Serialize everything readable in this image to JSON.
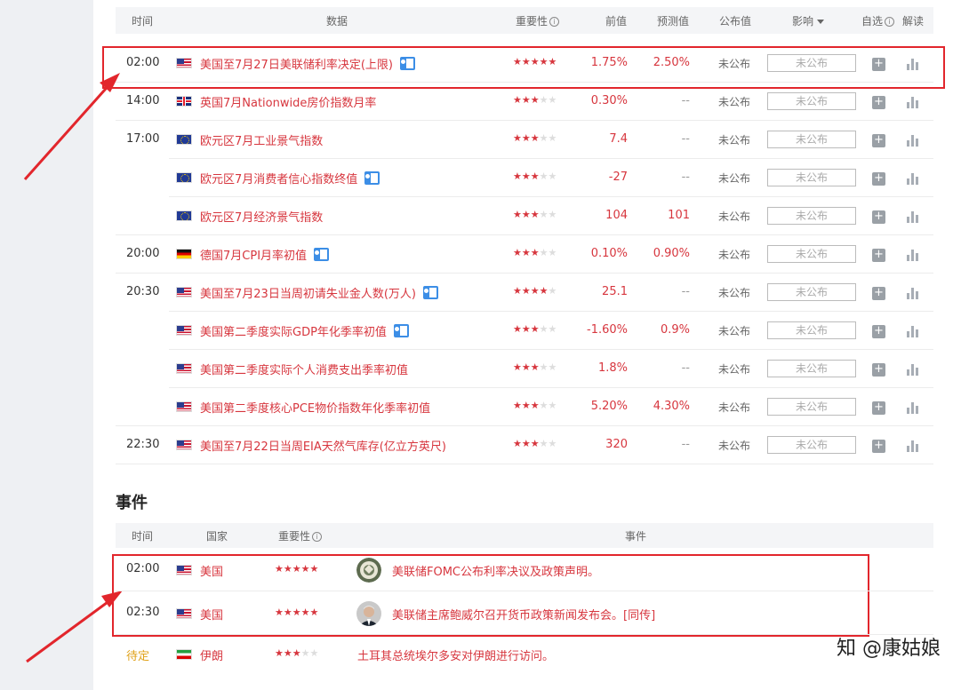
{
  "header": {
    "time": "时间",
    "data": "数据",
    "importance": "重要性",
    "importance_info": "i",
    "previous": "前值",
    "forecast": "预测值",
    "actual": "公布值",
    "impact": "影响",
    "watch": "自选",
    "watch_info": "i",
    "explain": "解读"
  },
  "rows": [
    {
      "time": "02:00",
      "flag": "us",
      "name": "美国至7月27日美联储利率决定(上限)",
      "doc": true,
      "stars": 5,
      "prev": "1.75%",
      "fore": "2.50%",
      "actual": "未公布",
      "impact": "未公布"
    },
    {
      "time": "14:00",
      "flag": "gb",
      "name": "英国7月Nationwide房价指数月率",
      "doc": false,
      "stars": 3,
      "prev": "0.30%",
      "fore": "--",
      "actual": "未公布",
      "impact": "未公布"
    },
    {
      "time": "17:00",
      "flag": "eu",
      "name": "欧元区7月工业景气指数",
      "doc": false,
      "stars": 3,
      "prev": "7.4",
      "fore": "--",
      "actual": "未公布",
      "impact": "未公布"
    },
    {
      "time": "",
      "flag": "eu",
      "name": "欧元区7月消费者信心指数终值",
      "doc": true,
      "stars": 3,
      "prev": "-27",
      "fore": "--",
      "actual": "未公布",
      "impact": "未公布"
    },
    {
      "time": "",
      "flag": "eu",
      "name": "欧元区7月经济景气指数",
      "doc": false,
      "stars": 3,
      "prev": "104",
      "fore": "101",
      "actual": "未公布",
      "impact": "未公布"
    },
    {
      "time": "20:00",
      "flag": "de",
      "name": "德国7月CPI月率初值",
      "doc": true,
      "stars": 3,
      "prev": "0.10%",
      "fore": "0.90%",
      "actual": "未公布",
      "impact": "未公布"
    },
    {
      "time": "20:30",
      "flag": "us",
      "name": "美国至7月23日当周初请失业金人数(万人)",
      "doc": true,
      "stars": 4,
      "prev": "25.1",
      "fore": "--",
      "actual": "未公布",
      "impact": "未公布"
    },
    {
      "time": "",
      "flag": "us",
      "name": "美国第二季度实际GDP年化季率初值",
      "doc": true,
      "stars": 3,
      "prev": "-1.60%",
      "fore": "0.9%",
      "actual": "未公布",
      "impact": "未公布"
    },
    {
      "time": "",
      "flag": "us",
      "name": "美国第二季度实际个人消费支出季率初值",
      "doc": false,
      "stars": 3,
      "prev": "1.8%",
      "fore": "--",
      "actual": "未公布",
      "impact": "未公布"
    },
    {
      "time": "",
      "flag": "us",
      "name": "美国第二季度核心PCE物价指数年化季率初值",
      "doc": false,
      "stars": 3,
      "prev": "5.20%",
      "fore": "4.30%",
      "actual": "未公布",
      "impact": "未公布"
    },
    {
      "time": "22:30",
      "flag": "us",
      "name": "美国至7月22日当周EIA天然气库存(亿立方英尺)",
      "doc": false,
      "stars": 3,
      "prev": "320",
      "fore": "--",
      "actual": "未公布",
      "impact": "未公布"
    }
  ],
  "plus_glyph": "+",
  "events": {
    "title": "事件",
    "header": {
      "time": "时间",
      "country": "国家",
      "importance": "重要性",
      "importance_info": "i",
      "event": "事件"
    },
    "rows": [
      {
        "time": "02:00",
        "flag": "us",
        "country": "美国",
        "stars": 5,
        "avatar": "fed-seal",
        "text": "美联储FOMC公布利率决议及政策声明。"
      },
      {
        "time": "02:30",
        "flag": "us",
        "country": "美国",
        "stars": 5,
        "avatar": "powell-portrait",
        "text": "美联储主席鲍威尔召开货币政策新闻发布会。[同传]"
      },
      {
        "time": "待定",
        "flag": "ir",
        "country": "伊朗",
        "stars": 3,
        "avatar": "",
        "text": "土耳其总统埃尔多安对伊朗进行访问。"
      }
    ]
  },
  "watermark": "知 @康姑娘",
  "colors": {
    "accent_red": "#d7363e",
    "highlight": "#e2262c",
    "pending": "#e0a21a",
    "header_bg": "#f4f5f7"
  }
}
